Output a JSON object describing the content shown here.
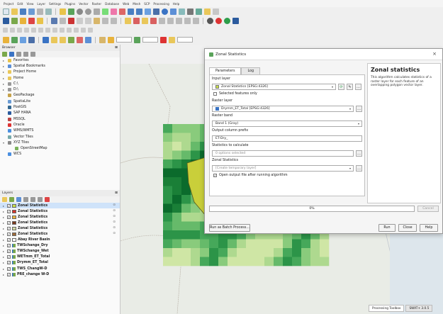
{
  "menu": [
    "Project",
    "Edit",
    "View",
    "Layer",
    "Settings",
    "Plugins",
    "Vector",
    "Raster",
    "Database",
    "Web",
    "Mesh",
    "SCP",
    "Processing",
    "Help"
  ],
  "browser": {
    "title": "Browser",
    "items": [
      {
        "label": "Favorites",
        "icon": "star-icon",
        "arrow": "▸"
      },
      {
        "label": "Spatial Bookmarks",
        "icon": "bookmark-icon",
        "arrow": "▸"
      },
      {
        "label": "Project Home",
        "icon": "folder-icon",
        "arrow": "▸"
      },
      {
        "label": "Home",
        "icon": "folder-icon",
        "arrow": "▸"
      },
      {
        "label": "C:\\",
        "icon": "drive-icon",
        "arrow": "▸"
      },
      {
        "label": "D:\\",
        "icon": "drive-icon",
        "arrow": "▸"
      },
      {
        "label": "GeoPackage",
        "icon": "geopackage-icon",
        "arrow": ""
      },
      {
        "label": "SpatiaLite",
        "icon": "spatialite-icon",
        "arrow": ""
      },
      {
        "label": "PostGIS",
        "icon": "postgis-icon",
        "arrow": ""
      },
      {
        "label": "SAP HANA",
        "icon": "saphana-icon",
        "arrow": ""
      },
      {
        "label": "MSSQL",
        "icon": "mssql-icon",
        "arrow": ""
      },
      {
        "label": "Oracle",
        "icon": "oracle-icon",
        "arrow": ""
      },
      {
        "label": "WMS/WMTS",
        "icon": "wms-icon",
        "arrow": ""
      },
      {
        "label": "Vector Tiles",
        "icon": "vectortiles-icon",
        "arrow": ""
      },
      {
        "label": "XYZ Tiles",
        "icon": "xyz-icon",
        "arrow": "▾"
      },
      {
        "label": "OpenStreetMap",
        "icon": "osm-icon",
        "arrow": "",
        "indent": true
      },
      {
        "label": "WCS",
        "icon": "wcs-icon",
        "arrow": ""
      }
    ]
  },
  "layers": {
    "title": "Layers",
    "items": [
      {
        "label": "Zonal Statistics",
        "swatch": "#c9e04a",
        "checked": true,
        "bold": true,
        "selected": true
      },
      {
        "label": "Zonal Statistics",
        "swatch": "#d7342b",
        "checked": true,
        "bold": true
      },
      {
        "label": "Zonal Statistics",
        "swatch": "#e8b23a",
        "checked": true,
        "bold": true
      },
      {
        "label": "Zonal Statistics",
        "swatch": "#7c3a1e",
        "checked": true,
        "bold": true
      },
      {
        "label": "Zonal Statistics",
        "swatch": "#cfd8a2",
        "checked": true,
        "bold": true
      },
      {
        "label": "Zonal Statistics",
        "swatch": "#9e6b3a",
        "checked": true,
        "bold": true
      },
      {
        "label": "Abay River Basin",
        "swatch": "#ffffff",
        "checked": true,
        "bold": true
      },
      {
        "label": "TWSchange_Dry",
        "swatch": "",
        "checked": true,
        "bold": true
      },
      {
        "label": "TWSchange_Wet",
        "swatch": "",
        "checked": true,
        "bold": true
      },
      {
        "label": "WETmm_ET_Total",
        "swatch": "",
        "checked": true,
        "bold": true
      },
      {
        "label": "Drymm_ET_Total",
        "swatch": "",
        "checked": true,
        "bold": true
      },
      {
        "label": "TWS_ChangW-D",
        "swatch": "",
        "checked": true,
        "bold": true
      },
      {
        "label": "PRE_change W-D",
        "swatch": "",
        "checked": true,
        "bold": true
      }
    ]
  },
  "dialog": {
    "title": "Zonal Statistics",
    "close": "×",
    "tabs": [
      "Parameters",
      "Log"
    ],
    "input_layer_label": "Input layer",
    "input_layer_value": "Zonal Statistics [EPSG:4326]",
    "selected_only": "Selected features only",
    "raster_layer_label": "Raster layer",
    "raster_layer_value": "Drymm_ET_Total [EPSG:4326]",
    "raster_band_label": "Raster band",
    "raster_band_value": "Band 1 (Gray)",
    "prefix_label": "Output column prefix",
    "prefix_value": "ET-Dry_",
    "stats_label": "Statistics to calculate",
    "stats_value": "0 options selected",
    "zonal_label": "Zonal Statistics",
    "zonal_placeholder": "[Create temporary layer]",
    "open_after": "Open output file after running algorithm",
    "progress": "0%",
    "cancel": "Cancel",
    "batch": "Run as Batch Process...",
    "run": "Run",
    "closeb": "Close",
    "help": "Help",
    "help_title": "Zonal statistics",
    "help_text": "This algorithm calculates statistics of a raster layer for each feature of an overlapping polygon vector layer."
  },
  "right_tabs": [
    "Processing Toolbox",
    "SWAT+ 3.0.5"
  ],
  "colors": {
    "accent": "#3a73c4",
    "dialog_bg": "#f5f5f5",
    "map_bg": "#e9ece6",
    "basin": "#c9cf3a"
  }
}
